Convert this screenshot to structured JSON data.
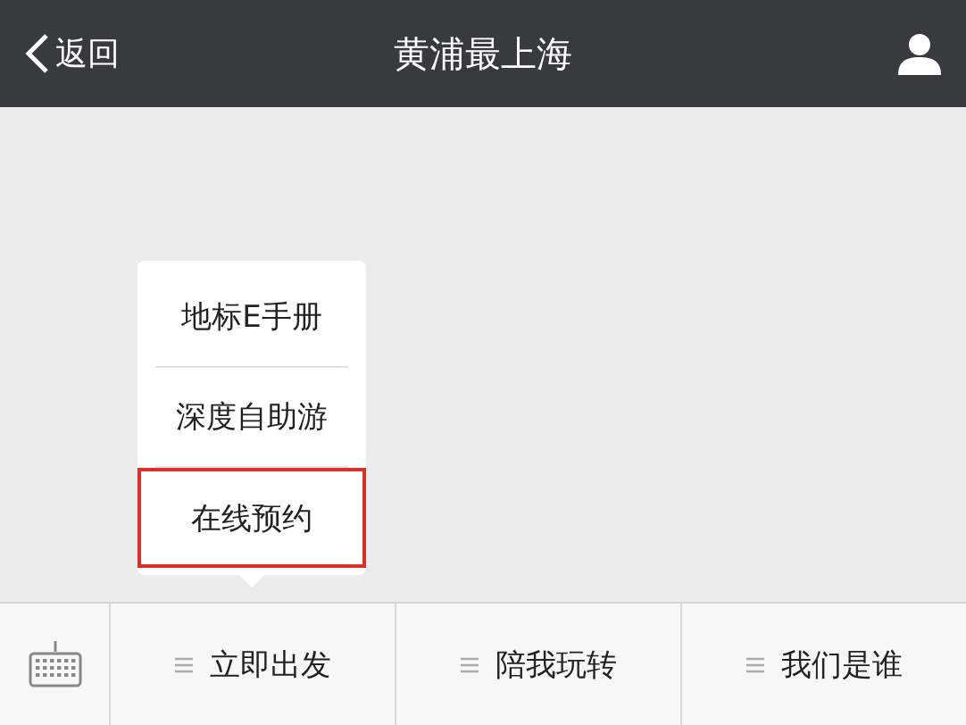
{
  "header": {
    "back": "返回",
    "title": "黄浦最上海"
  },
  "popup_menu": [
    {
      "label": "地标E手册",
      "selected": false
    },
    {
      "label": "深度自助游",
      "selected": false
    },
    {
      "label": "在线预约",
      "selected": true
    }
  ],
  "bottom_menu": [
    {
      "label": "立即出发"
    },
    {
      "label": "陪我玩转"
    },
    {
      "label": "我们是谁"
    }
  ]
}
